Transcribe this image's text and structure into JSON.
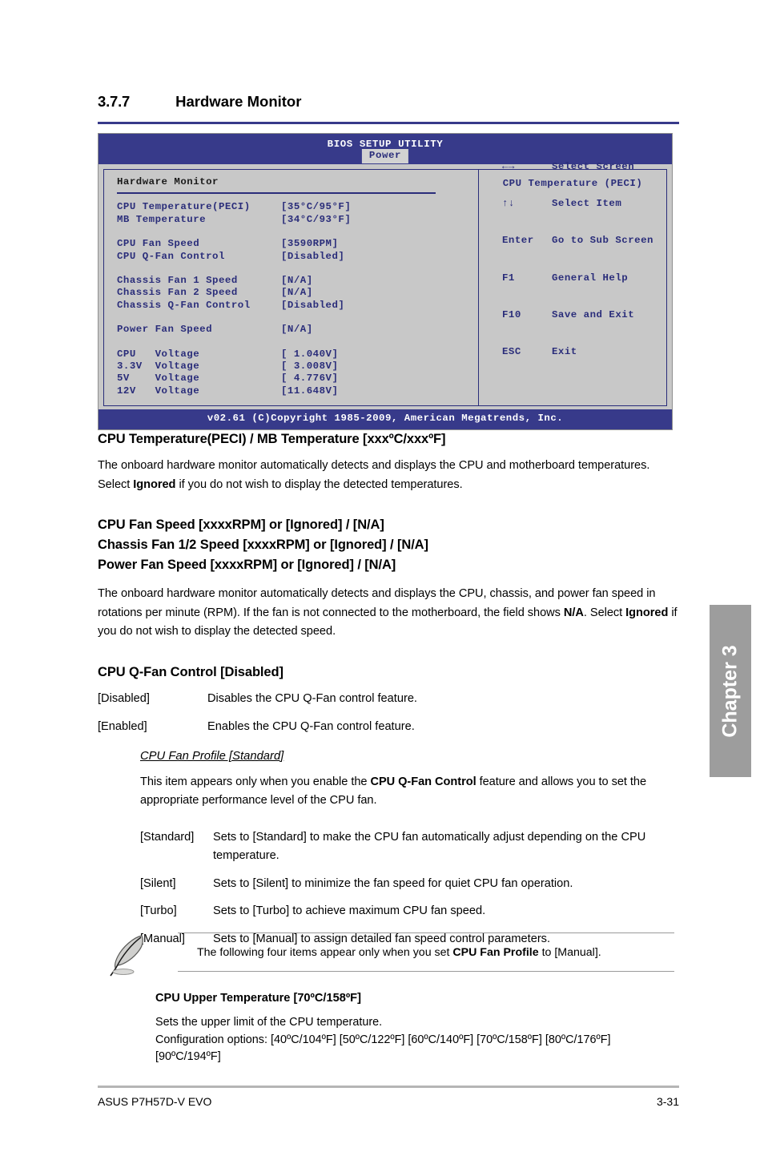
{
  "section": {
    "number": "3.7.7",
    "title": "Hardware Monitor"
  },
  "bios": {
    "title": "BIOS SETUP UTILITY",
    "tab": "Power",
    "panel_title": "Hardware Monitor",
    "help_title": "CPU Temperature (PECI)",
    "footer": "v02.61 (C)Copyright 1985-2009, American Megatrends, Inc.",
    "rows": [
      {
        "label": "CPU Temperature(PECI)",
        "value": "[35°C/95°F]"
      },
      {
        "label": "MB Temperature",
        "value": "[34°C/93°F]"
      },
      {
        "label": "CPU Fan Speed",
        "value": "[3590RPM]"
      },
      {
        "label": "CPU Q-Fan Control",
        "value": "[Disabled]"
      },
      {
        "label": "Chassis Fan 1 Speed",
        "value": "[N/A]"
      },
      {
        "label": "Chassis Fan 2 Speed",
        "value": "[N/A]"
      },
      {
        "label": "Chassis Q-Fan Control",
        "value": "[Disabled]"
      },
      {
        "label": "Power Fan Speed",
        "value": "[N/A]"
      },
      {
        "label": "CPU   Voltage",
        "value": "[ 1.040V]"
      },
      {
        "label": "3.3V  Voltage",
        "value": "[ 3.008V]"
      },
      {
        "label": "5V    Voltage",
        "value": "[ 4.776V]"
      },
      {
        "label": "12V   Voltage",
        "value": "[11.648V]"
      }
    ],
    "keys": [
      {
        "key": "←→",
        "action": "Select Screen"
      },
      {
        "key": "↑↓",
        "action": "Select Item"
      },
      {
        "key": "Enter",
        "action": "Go to Sub Screen"
      },
      {
        "key": "F1",
        "action": "General Help"
      },
      {
        "key": "F10",
        "action": "Save and Exit"
      },
      {
        "key": "ESC",
        "action": "Exit"
      }
    ],
    "colors": {
      "header_blue": "#373a8a",
      "text_blue": "#2a2d7a",
      "panel_gray": "#c8c8c8"
    }
  },
  "content": {
    "temp_heading": "CPU Temperature(PECI) / MB Temperature [xxxºC/xxxºF]",
    "temp_body_1": "The onboard hardware monitor automatically detects and displays the CPU and motherboard temperatures. Select ",
    "temp_body_bold": "Ignored",
    "temp_body_2": " if you do not wish to display the detected temperatures.",
    "fan_heading_1": "CPU Fan Speed [xxxxRPM] or [Ignored] / [N/A]",
    "fan_heading_2": "Chassis Fan 1/2 Speed [xxxxRPM] or [Ignored] / [N/A]",
    "fan_heading_3": "Power Fan Speed [xxxxRPM] or [Ignored] / [N/A]",
    "fan_body_1": "The onboard hardware monitor automatically detects and displays the CPU, chassis, and power fan speed in rotations per minute (RPM). If the fan is not connected to the motherboard, the field shows ",
    "fan_body_bold_1": "N/A",
    "fan_body_2": ". Select ",
    "fan_body_bold_2": "Ignored",
    "fan_body_3": " if you do not wish to display the detected speed.",
    "qfan_heading": "CPU Q-Fan Control [Disabled]",
    "qfan_options": [
      {
        "term": "[Disabled]",
        "desc": "Disables the CPU Q-Fan control feature."
      },
      {
        "term": "[Enabled]",
        "desc": "Enables the CPU Q-Fan control feature."
      }
    ],
    "profile_title": "CPU Fan Profile [Standard]",
    "profile_body_1": "This item appears only when you enable the ",
    "profile_body_bold": "CPU Q-Fan Control",
    "profile_body_2": " feature and allows you to set the appropriate performance level of the CPU fan.",
    "profile_options": [
      {
        "term": "[Standard]",
        "desc": "Sets to [Standard] to make the CPU fan automatically adjust depending on the CPU temperature."
      },
      {
        "term": "[Silent]",
        "desc": "Sets to [Silent] to minimize the fan speed for quiet CPU fan operation."
      },
      {
        "term": "[Turbo]",
        "desc": "Sets to [Turbo] to achieve maximum CPU fan speed."
      },
      {
        "term": "[Manual]",
        "desc": "Sets to [Manual] to assign detailed fan speed control parameters."
      }
    ],
    "note_1": "The following four items appear only when you set ",
    "note_bold": "CPU Fan Profile",
    "note_2": " to [Manual].",
    "upper_heading": "CPU Upper Temperature [70ºC/158ºF]",
    "upper_body_1": "Sets the upper limit of the CPU temperature.",
    "upper_body_2": "Configuration options: [40ºC/104ºF] [50ºC/122ºF] [60ºC/140ºF] [70ºC/158ºF] [80ºC/176ºF] [90ºC/194ºF]"
  },
  "chapter_tab": "Chapter 3",
  "footer": {
    "left": "ASUS P7H57D-V EVO",
    "right": "3-31"
  }
}
